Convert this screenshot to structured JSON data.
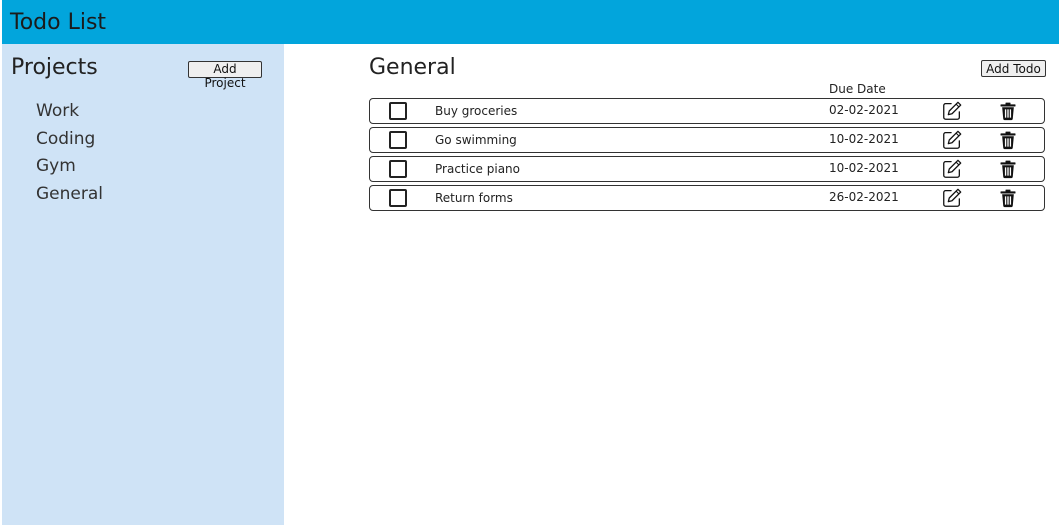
{
  "header": {
    "title": "Todo List"
  },
  "sidebar": {
    "title": "Projects",
    "add_project_label": "Add Project",
    "projects": [
      {
        "label": "Work"
      },
      {
        "label": "Coding"
      },
      {
        "label": "Gym"
      },
      {
        "label": "General"
      }
    ]
  },
  "main": {
    "title": "General",
    "add_todo_label": "Add Todo",
    "due_date_header": "Due Date",
    "todos": [
      {
        "name": "Buy groceries",
        "due": "02-02-2021",
        "checked": false
      },
      {
        "name": "Go swimming",
        "due": "10-02-2021",
        "checked": false
      },
      {
        "name": "Practice piano",
        "due": "10-02-2021",
        "checked": false
      },
      {
        "name": "Return forms",
        "due": "26-02-2021",
        "checked": false
      }
    ]
  },
  "colors": {
    "header_bg": "#02a5dc",
    "sidebar_bg": "#cfe3f6"
  },
  "icons": {
    "edit": "pencil-square-icon",
    "delete": "trash-icon"
  }
}
